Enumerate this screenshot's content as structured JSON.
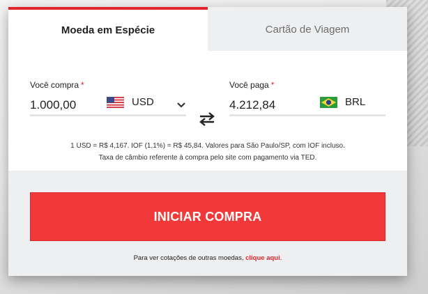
{
  "tabs": [
    {
      "label": "Moeda em Espécie",
      "active": true
    },
    {
      "label": "Cartão de Viagem",
      "active": false
    }
  ],
  "buy": {
    "label": "Você compra",
    "required_mark": "*",
    "amount": "1.000,00",
    "currency": "USD",
    "flag_icon": "us-flag-icon"
  },
  "pay": {
    "label": "Você paga",
    "required_mark": "*",
    "amount": "4.212,84",
    "currency": "BRL",
    "flag_icon": "br-flag-icon"
  },
  "info": {
    "line1": "1 USD = R$ 4,167. IOF (1,1%) = R$ 45,84. Valores para São Paulo/SP, com IOF incluso.",
    "line2": "Taxa de câmbio referente à compra pelo site com pagamento via TED."
  },
  "cta": {
    "label": "INICIAR COMPRA"
  },
  "footer": {
    "text": "Para ver cotações de outras moedas, ",
    "link": "clique aqui",
    "suffix": "."
  },
  "colors": {
    "accent": "#e2262c",
    "button": "#f13939",
    "tab_inactive_bg": "#eeeff1"
  }
}
